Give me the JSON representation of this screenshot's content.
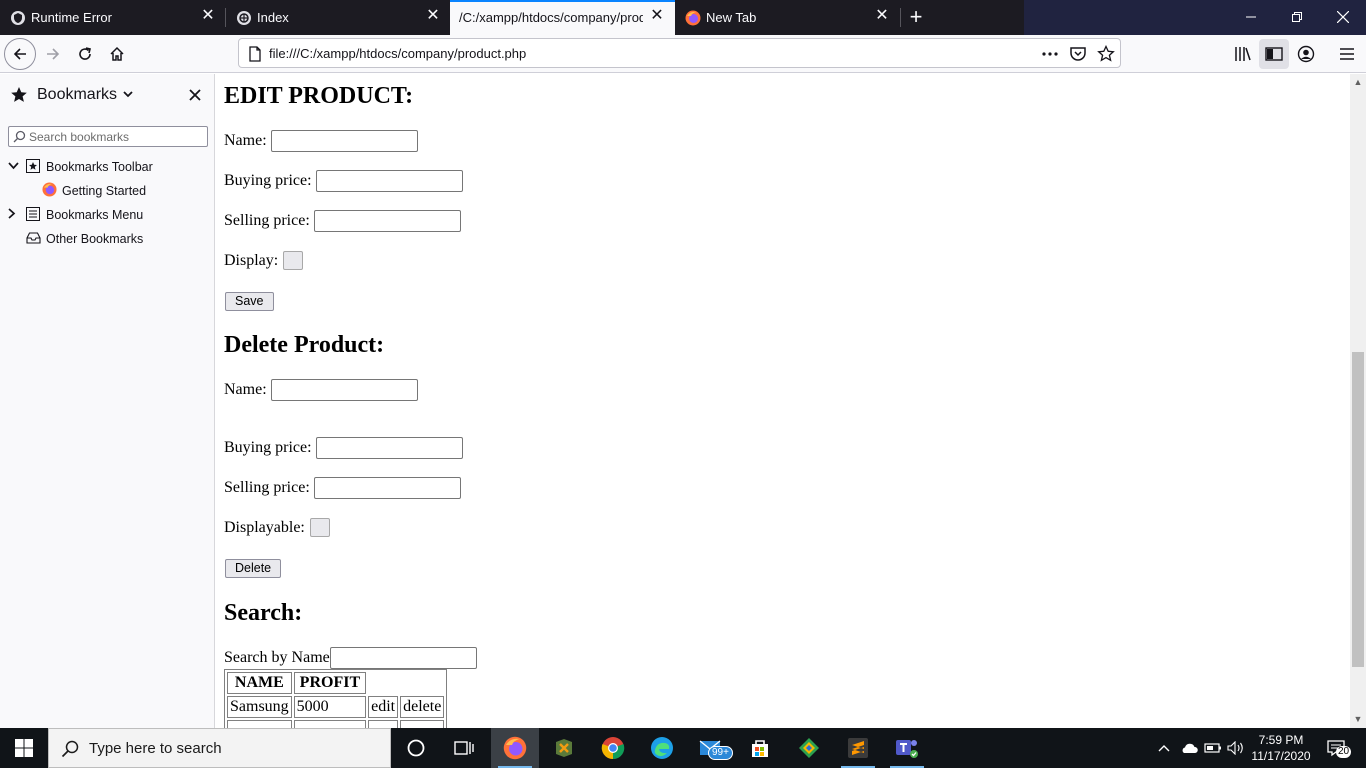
{
  "tabs": [
    {
      "title": "Runtime Error",
      "icon": "shield-icon"
    },
    {
      "title": "Index",
      "icon": "globe-icon"
    },
    {
      "title": "/C:/xampp/htdocs/company/product.php",
      "icon": "",
      "active": true
    },
    {
      "title": "New Tab",
      "icon": "firefox-icon"
    }
  ],
  "url": "file:///C:/xampp/htdocs/company/product.php",
  "sidebar": {
    "title": "Bookmarks",
    "search_placeholder": "Search bookmarks",
    "items": [
      {
        "label": "Bookmarks Toolbar",
        "expanded": true
      },
      {
        "label": "Getting Started"
      },
      {
        "label": "Bookmarks Menu",
        "expanded": false
      },
      {
        "label": "Other Bookmarks"
      }
    ]
  },
  "edit": {
    "heading": "EDIT PRODUCT:",
    "name_label": "Name:",
    "buying_label": "Buying price:",
    "selling_label": "Selling price:",
    "display_label": "Display:",
    "save_label": "Save"
  },
  "delete": {
    "heading": "Delete Product:",
    "name_label": "Name:",
    "buying_label": "Buying price:",
    "selling_label": "Selling price:",
    "display_label": "Displayable:",
    "delete_label": "Delete"
  },
  "search": {
    "heading": "Search:",
    "label": "Search by Name",
    "table": {
      "headers": [
        "NAME",
        "PROFIT"
      ],
      "rows": [
        {
          "name": "Samsung",
          "profit": "5000",
          "edit": "edit",
          "delete": "delete"
        }
      ]
    }
  },
  "taskbar": {
    "search_placeholder": "Type here to search",
    "mail_badge": "99+",
    "time": "7:59 PM",
    "date": "11/17/2020",
    "notifications": "20"
  },
  "colors": {
    "tabstrip": "#1c1b22",
    "accent": "#0a84ff",
    "taskbar": "#101418"
  }
}
